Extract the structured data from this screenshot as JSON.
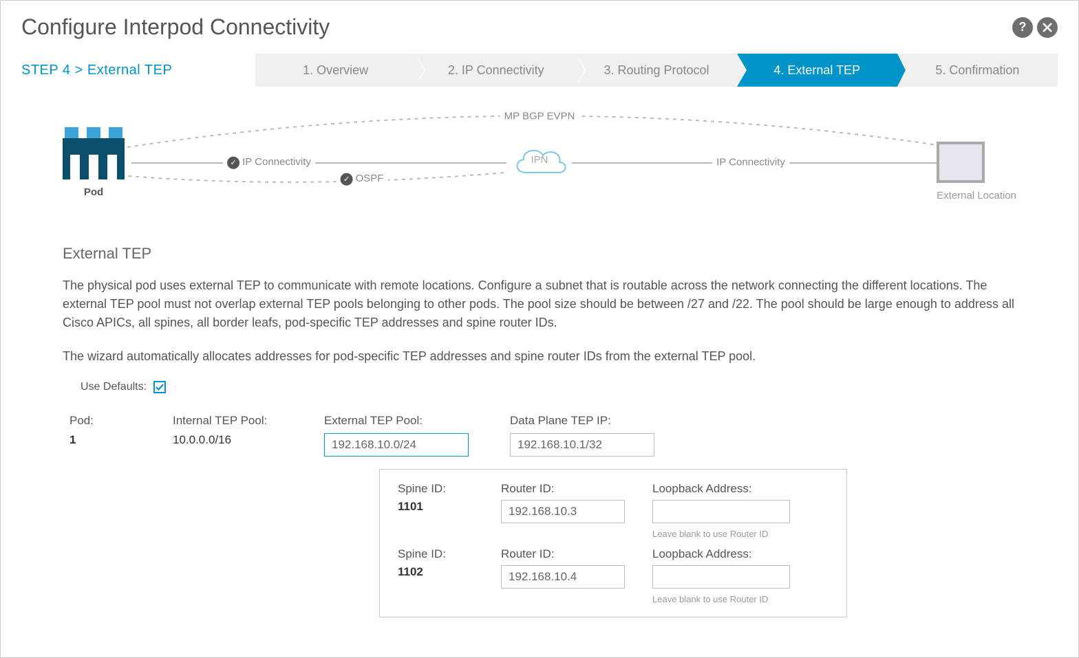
{
  "title": "Configure Interpod Connectivity",
  "step_label": "STEP 4 > External TEP",
  "wizard": {
    "s1": "1. Overview",
    "s2": "2. IP Connectivity",
    "s3": "3. Routing Protocol",
    "s4": "4. External TEP",
    "s5": "5. Confirmation"
  },
  "diagram": {
    "top_label": "MP BGP EVPN",
    "left_conn": "IP Connectivity",
    "ospf": "OSPF",
    "ipn": "IPN",
    "right_conn": "IP Connectivity",
    "pod_label": "Pod",
    "ext_label": "External Location"
  },
  "section_title": "External TEP",
  "desc1": "The physical pod uses external TEP to communicate with remote locations. Configure a subnet that is routable across the network connecting the different locations. The external TEP pool must not overlap external TEP pools belonging to other pods. The pool size should be between /27 and /22. The pool should be large enough to address all Cisco APICs, all spines, all border leafs, pod-specific TEP addresses and spine router IDs.",
  "desc2": "The wizard automatically allocates addresses for pod-specific TEP addresses and spine router IDs from the external TEP pool.",
  "use_defaults_label": "Use Defaults:",
  "labels": {
    "pod": "Pod:",
    "itep": "Internal TEP Pool:",
    "etep": "External TEP Pool:",
    "dptep": "Data Plane TEP IP:",
    "spine": "Spine ID:",
    "router": "Router ID:",
    "loop": "Loopback Address:",
    "hint": "Leave blank to use Router ID"
  },
  "values": {
    "pod": "1",
    "itep": "10.0.0.0/16",
    "etep": "192.168.10.0/24",
    "dptep": "192.168.10.1/32",
    "spine1": "1101",
    "router1": "192.168.10.3",
    "spine2": "1102",
    "router2": "192.168.10.4"
  }
}
